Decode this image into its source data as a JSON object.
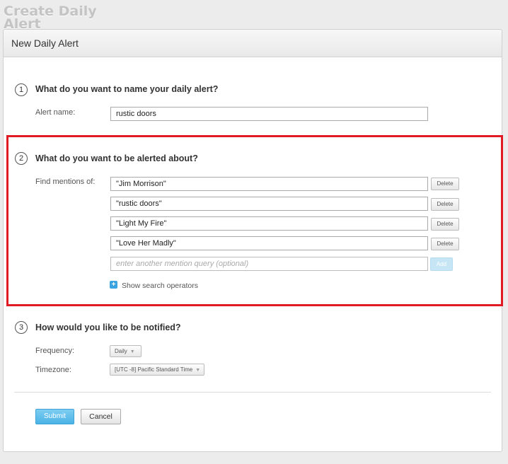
{
  "page_title": "Create Daily Alert",
  "panel": {
    "header": "New Daily Alert"
  },
  "steps": [
    {
      "number": "1",
      "question": "What do you want to name your daily alert?"
    },
    {
      "number": "2",
      "question": "What do you want to be alerted about?"
    },
    {
      "number": "3",
      "question": "How would you like to be notified?"
    }
  ],
  "alert_name": {
    "label": "Alert name:",
    "value": "rustic doors"
  },
  "mentions": {
    "label": "Find mentions of:",
    "queries": [
      "\"Jim Morrison\"",
      "\"rustic doors\"",
      "\"Light My Fire\"",
      "\"Love Her Madly\""
    ],
    "delete_label": "Delete",
    "new_placeholder": "enter another mention query (optional)",
    "add_label": "Add",
    "operators_link": "Show search operators",
    "operators_icon": "plus-icon"
  },
  "notify": {
    "frequency_label": "Frequency:",
    "frequency_value": "Daily",
    "timezone_label": "Timezone:",
    "timezone_value": "[UTC -8] Pacific Standard Time"
  },
  "actions": {
    "submit": "Submit",
    "cancel": "Cancel"
  },
  "colors": {
    "highlight": "#e01b24",
    "submit": "#4ab3e6",
    "add": "#c7e6f5"
  }
}
